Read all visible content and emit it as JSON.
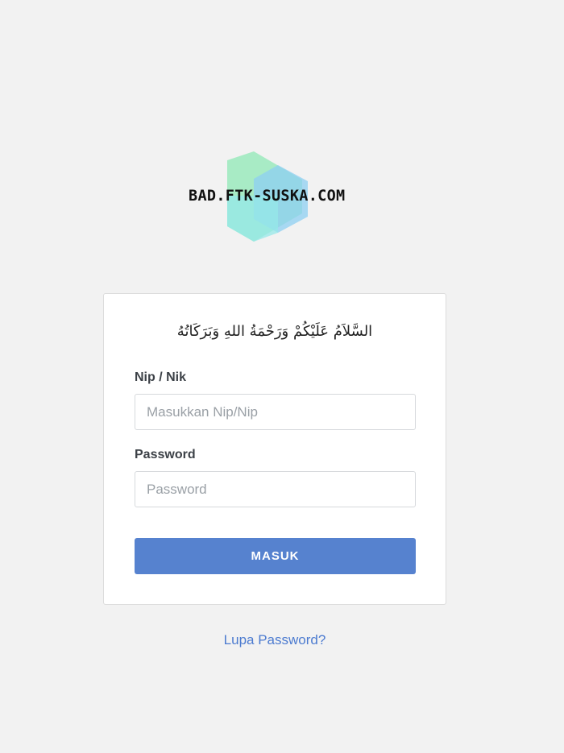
{
  "logo": {
    "text": "BAD.FTK-SUSKA.COM",
    "colors": [
      "#8fe3b0",
      "#8fd3f0",
      "#95e6e6"
    ]
  },
  "login": {
    "greeting": "السَّلاَمُ عَلَيْكُمْ وَرَحْمَةُ اللهِ وَبَرَكَاتُهُ",
    "nip_label": "Nip / Nik",
    "nip_placeholder": "Masukkan Nip/Nip",
    "password_label": "Password",
    "password_placeholder": "Password",
    "submit_label": "MASUK",
    "forgot_label": "Lupa Password?"
  },
  "colors": {
    "background": "#f2f2f2",
    "button": "#5682cf",
    "link": "#4c7bd0"
  }
}
